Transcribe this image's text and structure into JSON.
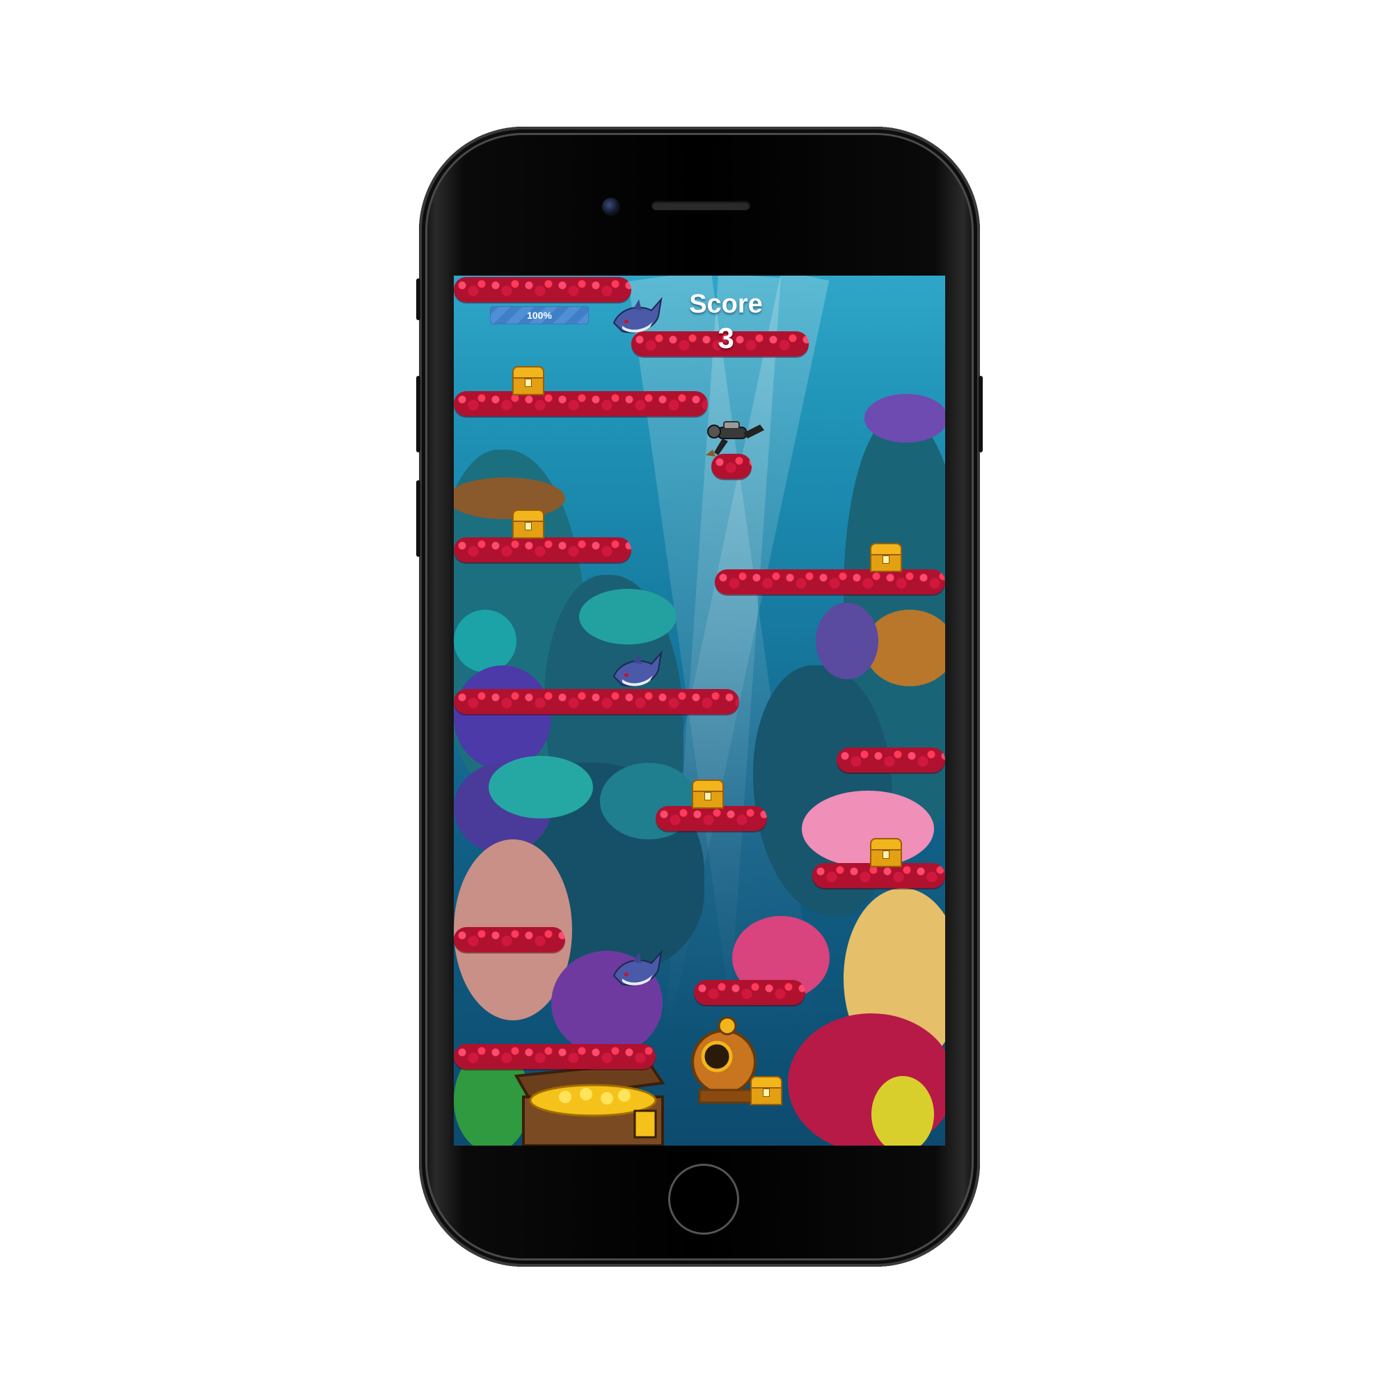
{
  "hud": {
    "score_title": "Score",
    "score_value": "3",
    "health_label": "100%",
    "health_fraction": 1.0
  },
  "colors": {
    "water_top": "#2fa6c8",
    "water_bottom": "#0d4b6e",
    "platform_red": "#b0112f",
    "chest_gold": "#f2b51c",
    "progress_blue": "#4f8fd6"
  },
  "entities": {
    "platform_count": 13,
    "chest_count": 7,
    "shark_count": 3,
    "diver_count": 1,
    "icons": [
      "coral-platform-icon",
      "treasure-chest-icon",
      "shark-icon",
      "diver-icon",
      "diving-helmet-icon"
    ]
  }
}
